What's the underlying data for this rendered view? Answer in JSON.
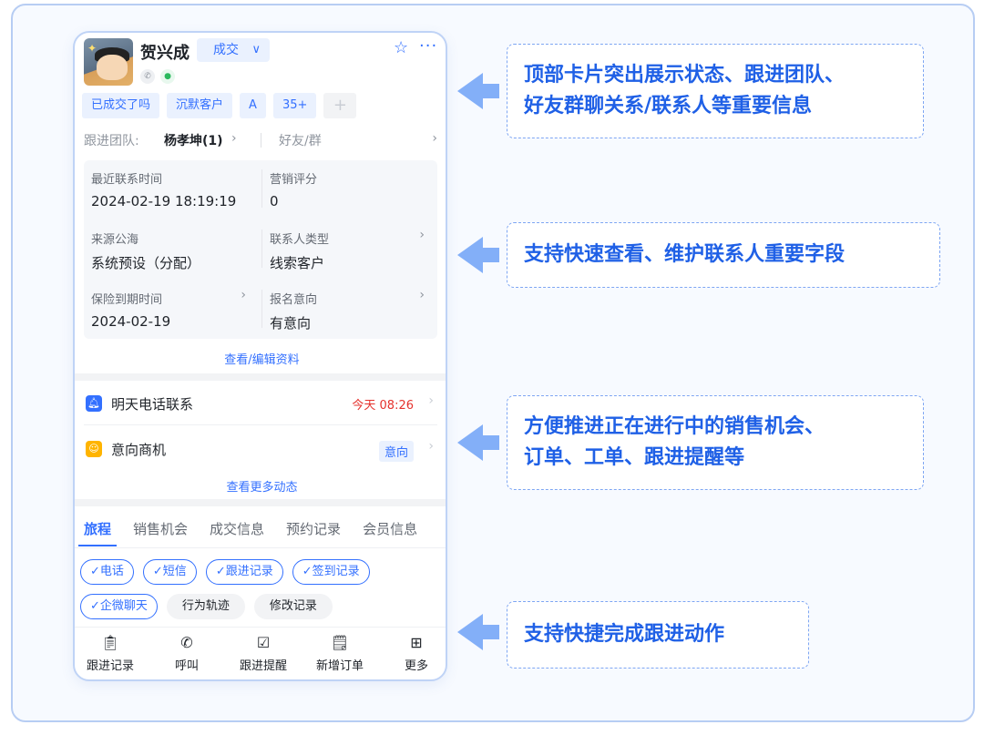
{
  "contact": {
    "name": "贺兴成",
    "stage": "成交",
    "tags": [
      "已成交了吗",
      "沉默客户",
      "A",
      "35+"
    ],
    "team_label": "跟进团队:",
    "team_value": "杨孝坤(1)",
    "friends_label": "好友/群"
  },
  "fields": [
    {
      "key": "最近联系时间",
      "value": "2024-02-19 18:19:19"
    },
    {
      "key": "营销评分",
      "value": "0"
    },
    {
      "key": "来源公海",
      "value": "系统预设（分配）"
    },
    {
      "key": "联系人类型",
      "value": "线索客户"
    },
    {
      "key": "保险到期时间",
      "value": "2024-02-19"
    },
    {
      "key": "报名意向",
      "value": "有意向"
    }
  ],
  "edit_link": "查看/编辑资料",
  "activities": [
    {
      "title": "明天电话联系",
      "right": "今天 08:26",
      "right_color": "#e5322d"
    },
    {
      "title": "意向商机",
      "right": "意向"
    }
  ],
  "more_link": "查看更多动态",
  "tabs": [
    "旅程",
    "销售机会",
    "成交信息",
    "预约记录",
    "会员信息"
  ],
  "filter_chips_row1": [
    "✓电话",
    "✓短信",
    "✓跟进记录",
    "✓签到记录"
  ],
  "filter_chips_row2_on": "✓企微聊天",
  "filter_chips_row2_off": [
    "行为轨迹",
    "修改记录"
  ],
  "bottom_actions": [
    "跟进记录",
    "呼叫",
    "跟进提醒",
    "新增订单",
    "更多"
  ],
  "callouts": [
    "顶部卡片突出展示状态、跟进团队、\n好友群聊关系/联系人等重要信息",
    "支持快速查看、维护联系人重要字段",
    "方便推进正在进行中的销售机会、\n订单、工单、跟进提醒等",
    "支持快捷完成跟进动作"
  ],
  "colors": {
    "accent": "#3370ff",
    "callout_text": "#1f60e6",
    "arrow": "#4c8bf5"
  }
}
